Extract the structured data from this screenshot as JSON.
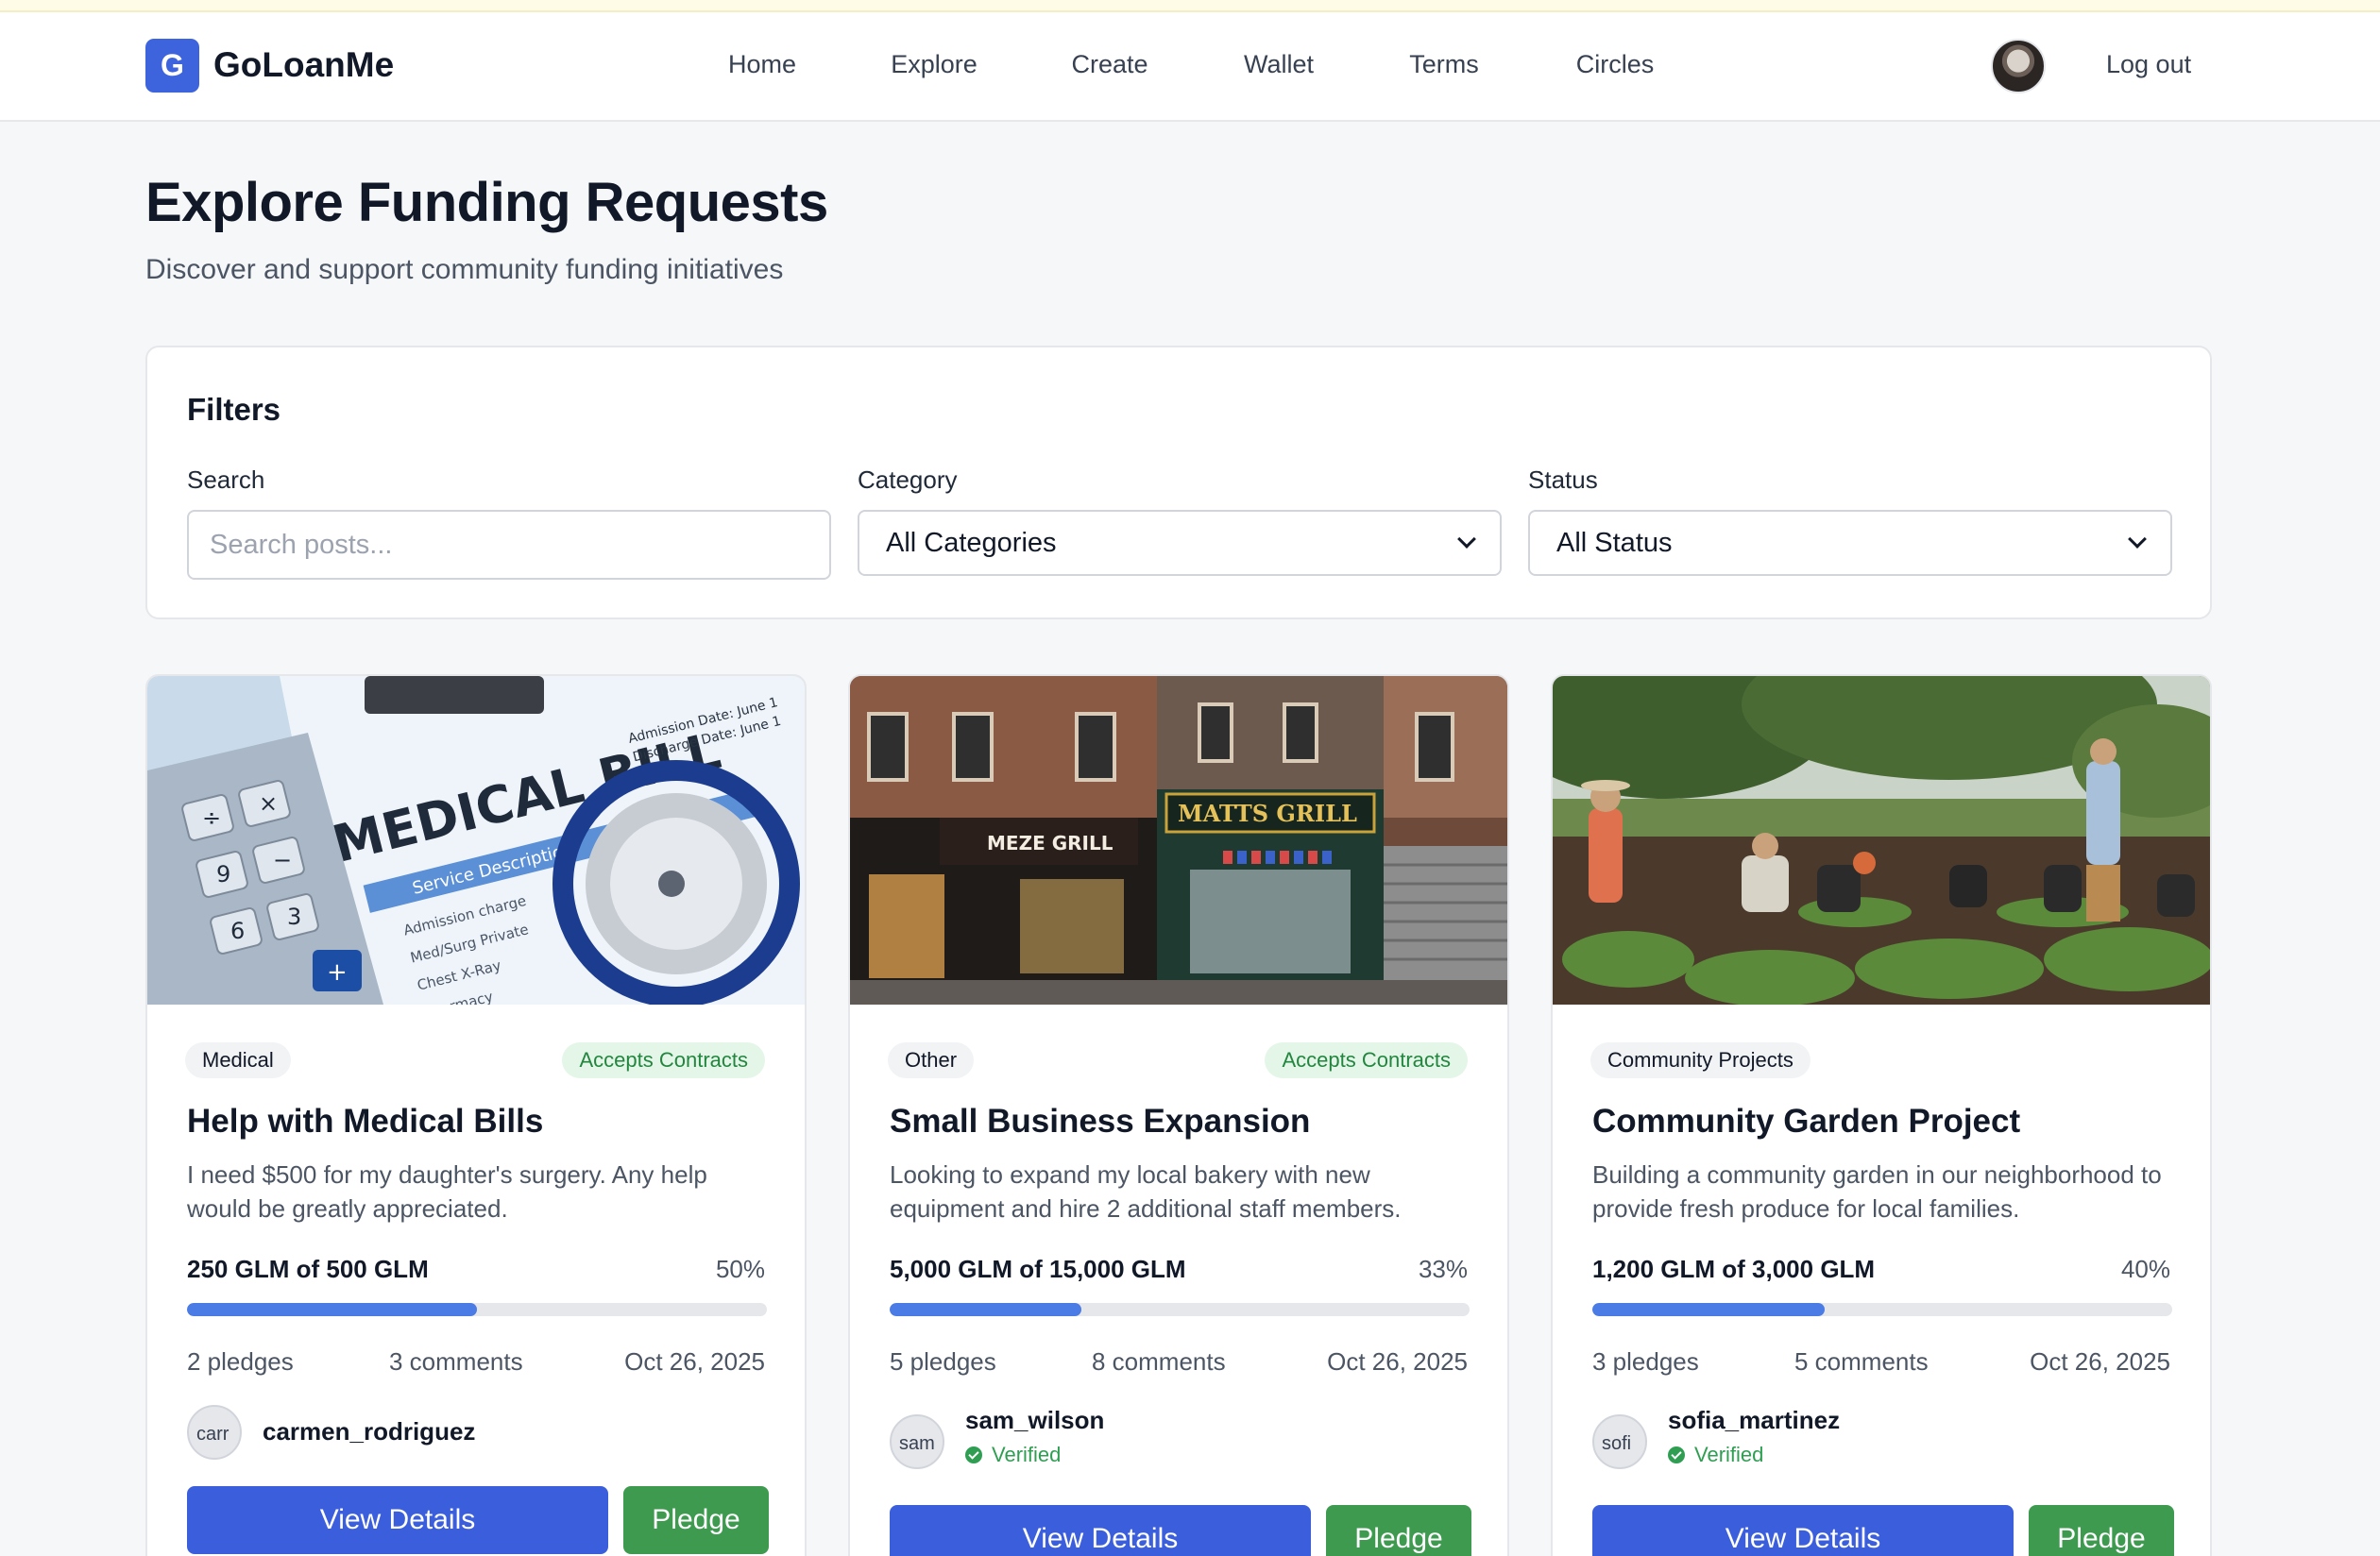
{
  "brand": {
    "logo_letter": "G",
    "name": "GoLoanMe"
  },
  "nav": {
    "links": [
      "Home",
      "Explore",
      "Create",
      "Wallet",
      "Terms",
      "Circles"
    ],
    "logout": "Log out"
  },
  "page": {
    "title": "Explore Funding Requests",
    "subtitle": "Discover and support community funding initiatives"
  },
  "filters": {
    "title": "Filters",
    "search_label": "Search",
    "search_placeholder": "Search posts...",
    "category_label": "Category",
    "category_value": "All Categories",
    "status_label": "Status",
    "status_value": "All Status"
  },
  "cards": [
    {
      "category": "Medical",
      "contract_badge": "Accepts Contracts",
      "title": "Help with Medical Bills",
      "description": "I need $500 for my daughter's surgery. Any help would be greatly appreciated.",
      "amount": "250 GLM of 500 GLM",
      "percent_label": "50%",
      "progress": 0.5,
      "pledges": "2 pledges",
      "comments": "3 comments",
      "date": "Oct 26, 2025",
      "avatar_alt": "carr",
      "username": "carmen_rodriguez",
      "verified": "",
      "view_label": "View Details",
      "pledge_label": "Pledge"
    },
    {
      "category": "Other",
      "contract_badge": "Accepts Contracts",
      "title": "Small Business Expansion",
      "description": "Looking to expand my local bakery with new equipment and hire 2 additional staff members.",
      "amount": "5,000 GLM of 15,000 GLM",
      "percent_label": "33%",
      "progress": 0.33,
      "pledges": "5 pledges",
      "comments": "8 comments",
      "date": "Oct 26, 2025",
      "avatar_alt": "sam",
      "username": "sam_wilson",
      "verified": "Verified",
      "view_label": "View Details",
      "pledge_label": "Pledge"
    },
    {
      "category": "Community Projects",
      "contract_badge": "",
      "title": "Community Garden Project",
      "description": "Building a community garden in our neighborhood to provide fresh produce for local families.",
      "amount": "1,200 GLM of 3,000 GLM",
      "percent_label": "40%",
      "progress": 0.4,
      "pledges": "3 pledges",
      "comments": "5 comments",
      "date": "Oct 26, 2025",
      "avatar_alt": "sofi",
      "username": "sofia_martinez",
      "verified": "Verified",
      "view_label": "View Details",
      "pledge_label": "Pledge"
    }
  ],
  "images": {
    "medical_text": "MEDICAL BILL",
    "medical_line1": "Admission Date: June 1",
    "medical_line2": "Discharge Date: June 1",
    "medical_service": "Service Description",
    "medical_items": [
      "Admission charge",
      "Med/Surg Private",
      "Chest X-Ray",
      "Pharmacy"
    ],
    "calc_keys": [
      "3",
      "6",
      "9",
      "+",
      "−",
      "×",
      "÷"
    ],
    "store_left": "MEZE GRILL",
    "store_right": "MATTS GRILL"
  }
}
